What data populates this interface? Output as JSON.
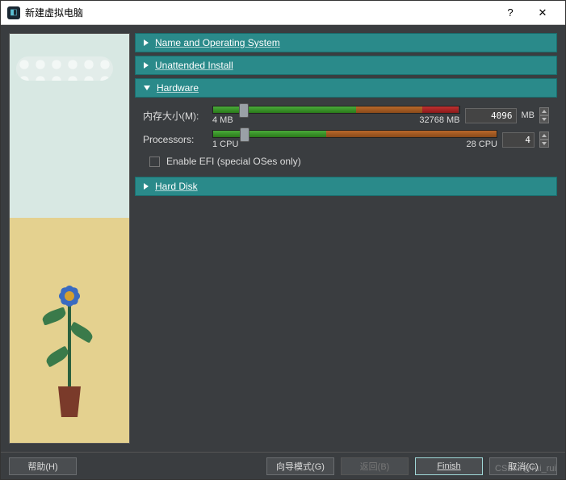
{
  "titlebar": {
    "title": "新建虚拟电脑",
    "help_glyph": "?",
    "close_glyph": "✕"
  },
  "sections": {
    "name_os": {
      "label": "Name and Operating System",
      "expanded": false
    },
    "unattended": {
      "label": "Unattended Install",
      "expanded": false
    },
    "hardware": {
      "label": "Hardware",
      "expanded": true
    },
    "hard_disk": {
      "label": "Hard Disk",
      "expanded": false
    }
  },
  "hardware": {
    "memory": {
      "label": "内存大小(M):",
      "min_label": "4 MB",
      "max_label": "32768 MB",
      "value": "4096",
      "unit": "MB",
      "min": 4,
      "max": 32768,
      "green_end_pct": 58,
      "orange_end_pct": 85,
      "thumb_pct": 12.5
    },
    "processors": {
      "label": "Processors:",
      "min_label": "1 CPU",
      "max_label": "28 CPU",
      "value": "4",
      "min": 1,
      "max": 28,
      "green_end_pct": 40,
      "thumb_pct": 11
    },
    "efi": {
      "label": "Enable EFI (special OSes only)",
      "checked": false
    }
  },
  "footer": {
    "help": "帮助(H)",
    "guided_mode": "向导模式(G)",
    "back": "返回(B)",
    "finish": "Finish",
    "cancel": "取消(C)"
  },
  "watermark": "CSDN @rui_rui"
}
